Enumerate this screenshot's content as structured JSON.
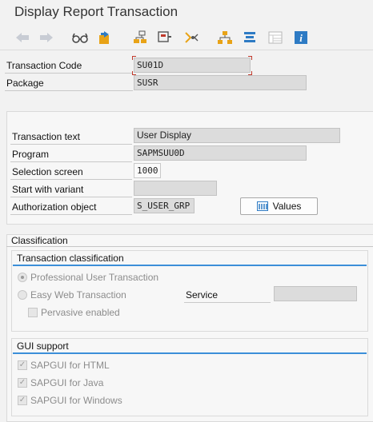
{
  "window": {
    "title": "Display Report Transaction"
  },
  "toolbar": {
    "icons": [
      "back-arrow-icon",
      "forward-arrow-icon",
      "glasses-icon",
      "object-switch-icon",
      "where-used-icon",
      "find-icon",
      "display-object-list-icon",
      "hierarchy-icon",
      "navigation-window-icon",
      "layout-icon",
      "info-icon"
    ]
  },
  "header": {
    "transaction_code_label": "Transaction Code",
    "transaction_code_value": "SU01D",
    "package_label": "Package",
    "package_value": "SUSR"
  },
  "details": {
    "transaction_text_label": "Transaction text",
    "transaction_text_value": "User Display",
    "program_label": "Program",
    "program_value": "SAPMSUU0D",
    "selection_screen_label": "Selection screen",
    "selection_screen_value": "1000",
    "start_variant_label": "Start with variant",
    "start_variant_value": "",
    "auth_object_label": "Authorization object",
    "auth_object_value": "S_USER_GRP",
    "values_button": "Values"
  },
  "classification": {
    "title": "Classification",
    "transaction_group_title": "Transaction classification",
    "radio_professional": "Professional User Transaction",
    "radio_easy_web": "Easy Web Transaction",
    "service_label": "Service",
    "service_value": "",
    "pervasive_label": "Pervasive enabled",
    "gui_support_title": "GUI support",
    "gui_html": "SAPGUI for HTML",
    "gui_java": "SAPGUI for Java",
    "gui_windows": "SAPGUI for Windows"
  },
  "colors": {
    "accent": "#3c8fd9",
    "field_bg": "#dcdcdc",
    "panel_bg": "#f7f7f7"
  }
}
